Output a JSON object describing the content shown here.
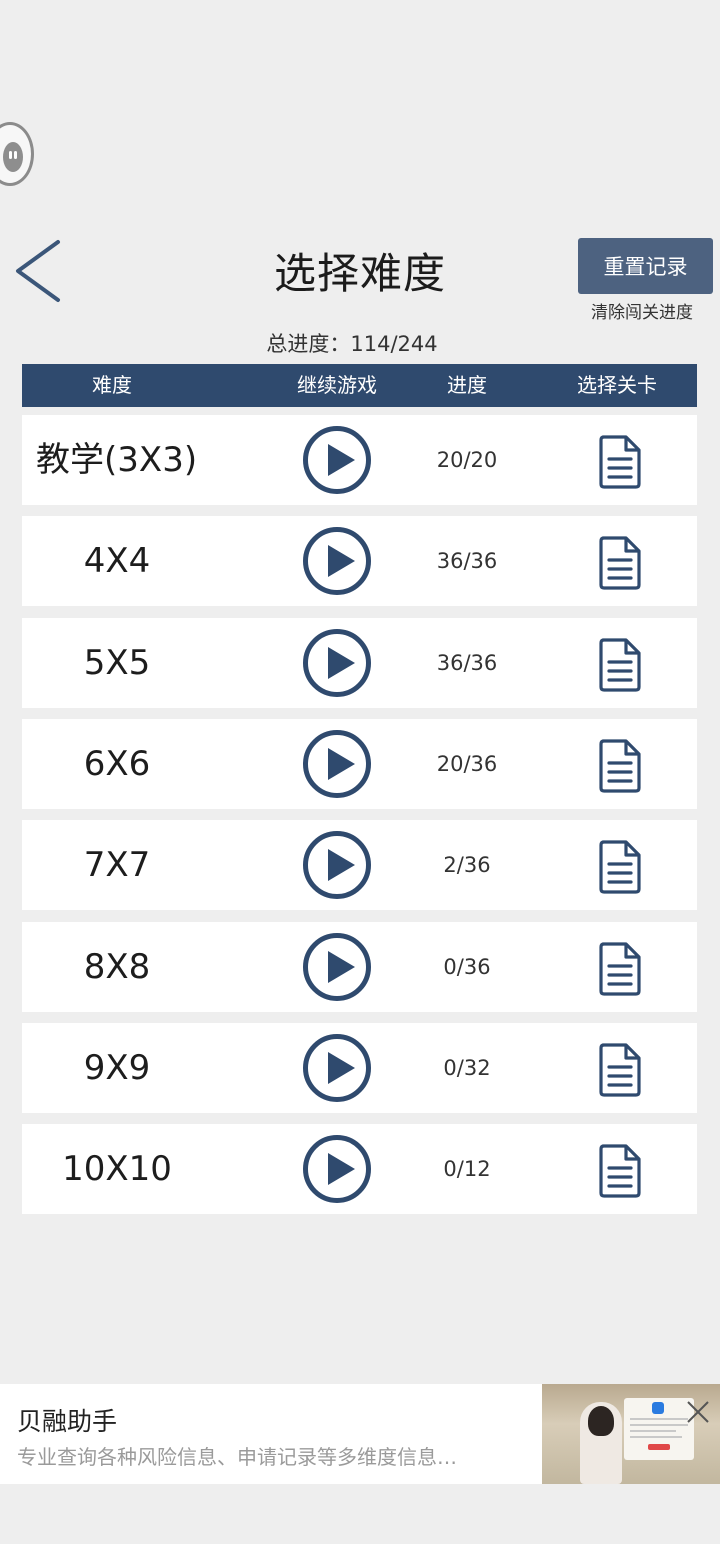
{
  "header": {
    "title": "选择难度",
    "reset_label": "重置记录",
    "reset_note": "清除闯关进度",
    "total_progress": "总进度：114/244"
  },
  "table": {
    "columns": [
      "难度",
      "继续游戏",
      "进度",
      "选择关卡"
    ],
    "rows": [
      {
        "name": "教学(3X3)",
        "progress": "20/20"
      },
      {
        "name": "4X4",
        "progress": "36/36"
      },
      {
        "name": "5X5",
        "progress": "36/36"
      },
      {
        "name": "6X6",
        "progress": "20/36"
      },
      {
        "name": "7X7",
        "progress": "2/36"
      },
      {
        "name": "8X8",
        "progress": "0/36"
      },
      {
        "name": "9X9",
        "progress": "0/32"
      },
      {
        "name": "10X10",
        "progress": "0/12"
      }
    ]
  },
  "ad": {
    "title": "贝融助手",
    "description": "专业查询各种风险信息、申请记录等多维度信息…"
  },
  "colors": {
    "accent": "#2f4a6e",
    "reset_button": "#4d6280",
    "background": "#eeeeee"
  },
  "icons": {
    "back": "chevron-left-icon",
    "play": "play-circle-icon",
    "document": "document-icon",
    "close": "close-icon",
    "assistant": "floating-assistant-icon"
  }
}
